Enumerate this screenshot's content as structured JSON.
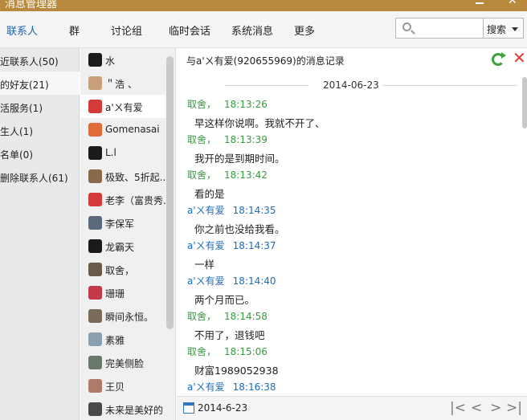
{
  "window": {
    "title": "消息管理器"
  },
  "tabs": [
    {
      "label": "联系人",
      "active": true
    },
    {
      "label": "群"
    },
    {
      "label": "讨论组"
    },
    {
      "label": "临时会话"
    },
    {
      "label": "系统消息"
    },
    {
      "label": "更多"
    }
  ],
  "search": {
    "placeholder": "",
    "button_label": "搜索"
  },
  "categories": [
    {
      "label": "近联系人(50)"
    },
    {
      "label": "的好友(21)",
      "active": true
    },
    {
      "label": "活服务(1)"
    },
    {
      "label": "生人(1)"
    },
    {
      "label": "名单(0)"
    },
    {
      "label": "删除联系人(61)"
    }
  ],
  "contacts": [
    {
      "name": "水",
      "avatar_color": "#1a1a1a"
    },
    {
      "name": "＂浩  、",
      "avatar_color": "#c9a07a"
    },
    {
      "name": "a'ㄨ有爱",
      "avatar_color": "#d43a3a",
      "active": true
    },
    {
      "name": "Gomenasai",
      "avatar_color": "#e06a3a"
    },
    {
      "name": "L.l",
      "avatar_color": "#1a1a1a"
    },
    {
      "name": "极致、5折起...",
      "avatar_color": "#8a6a4a"
    },
    {
      "name": "老李（富贵秀...",
      "avatar_color": "#d43a3a"
    },
    {
      "name": "李保军",
      "avatar_color": "#5a6a7a"
    },
    {
      "name": "龙霸天",
      "avatar_color": "#1a1a1a"
    },
    {
      "name": "取舍，",
      "avatar_color": "#6a5a4a"
    },
    {
      "name": "珊珊",
      "avatar_color": "#c43a4a"
    },
    {
      "name": "瞬间永恒。",
      "avatar_color": "#7a6a5a"
    },
    {
      "name": "素雅",
      "avatar_color": "#8aa0b0"
    },
    {
      "name": "完美侧脸",
      "avatar_color": "#6a7a6a"
    },
    {
      "name": "王贝",
      "avatar_color": "#b07a6a"
    },
    {
      "name": "未来是美好的",
      "avatar_color": "#4a4a4a"
    }
  ],
  "chat": {
    "header": "与a'ㄨ有爱(920655969)的消息记录",
    "date_separator": "2014-06-23",
    "messages": [
      {
        "sender": "取舍，",
        "time": "18:13:26",
        "text": "早这样你说啊。我就不开了、",
        "self": true
      },
      {
        "sender": "取舍，",
        "time": "18:13:39",
        "text": " 我开的是到期时间。",
        "self": true
      },
      {
        "sender": "取舍，",
        "time": "18:13:42",
        "text": "看的是",
        "self": true
      },
      {
        "sender": "a'ㄨ有爱",
        "time": "18:14:35",
        "text": "你之前也没给我看。",
        "self": false
      },
      {
        "sender": "a'ㄨ有爱",
        "time": "18:14:37",
        "text": "一样",
        "self": false
      },
      {
        "sender": "a'ㄨ有爱",
        "time": "18:14:40",
        "text": "两个月而已。",
        "self": false
      },
      {
        "sender": "取舍，",
        "time": "18:14:58",
        "text": "不用了，退钱吧",
        "self": true
      },
      {
        "sender": "取舍，",
        "time": "18:15:06",
        "text": "财富1989052938",
        "self": true
      },
      {
        "sender": "a'ㄨ有爱",
        "time": "18:16:38",
        "text": "",
        "self": false
      }
    ]
  },
  "bottom": {
    "date": "2014-6-23",
    "nav": [
      "|<",
      "<",
      ">",
      ">|"
    ]
  },
  "colors": {
    "self_sender": "#3a9a43",
    "other_sender": "#1f6cb8",
    "active_tab": "#1a64b8",
    "titlebar": "#b98a3e"
  }
}
